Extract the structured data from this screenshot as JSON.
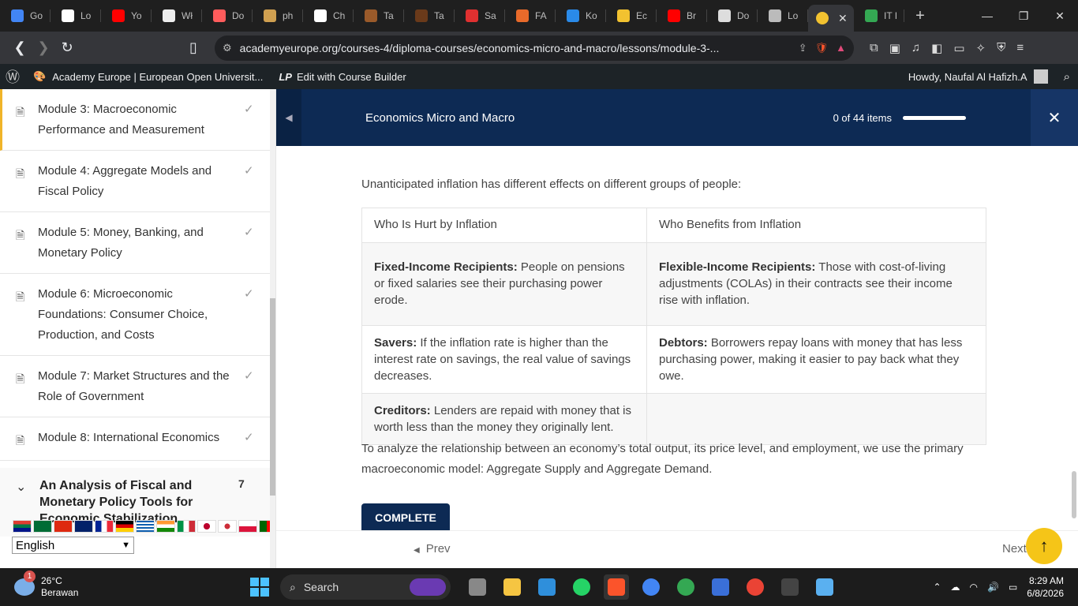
{
  "browser": {
    "tabs": [
      {
        "label": "Go",
        "color": "#4285f4"
      },
      {
        "label": "Lo",
        "color": "#ffffff"
      },
      {
        "label": "Yo",
        "color": "#ff0000"
      },
      {
        "label": "Wł",
        "color": "#eeeeee"
      },
      {
        "label": "Do",
        "color": "#ff5c5c"
      },
      {
        "label": "ph",
        "color": "#d0a050"
      },
      {
        "label": "Ch",
        "color": "#ffffff"
      },
      {
        "label": "Ta",
        "color": "#9a5a2a"
      },
      {
        "label": "Ta",
        "color": "#6a3a1a"
      },
      {
        "label": "Sa",
        "color": "#e03030"
      },
      {
        "label": "FA",
        "color": "#e86a2a"
      },
      {
        "label": "Ko",
        "color": "#2a8ae8"
      },
      {
        "label": "Ec",
        "color": "#f2c230"
      },
      {
        "label": "Br",
        "color": "#ff0000"
      },
      {
        "label": "Do",
        "color": "#dddddd"
      },
      {
        "label": "Lo",
        "color": "#bbbbbb"
      }
    ],
    "active_tab": {
      "label": "",
      "color": "#f2c230"
    },
    "last_tab": {
      "label": "IT I",
      "color": "#34a853"
    },
    "url": "academyeurope.org/courses-4/diploma-courses/economics-micro-and-macro/lessons/module-3-..."
  },
  "adminbar": {
    "site_name": "Academy Europe | European Open Universit...",
    "builder_label": "Edit with Course Builder",
    "howdy": "Howdy, Naufal Al Hafizh.A"
  },
  "sidebar": {
    "modules": [
      {
        "label": "Module 3: Macroeconomic Performance and Measurement"
      },
      {
        "label": "Module 4: Aggregate Models and Fiscal Policy"
      },
      {
        "label": "Module 5: Money, Banking, and Monetary Policy"
      },
      {
        "label": "Module 6: Microeconomic Foundations: Consumer Choice, Production, and Costs"
      },
      {
        "label": "Module 7: Market Structures and the Role of Government"
      },
      {
        "label": "Module 8: International Economics"
      }
    ],
    "section_title": "An Analysis of Fiscal and Monetary Policy Tools for Economic Stabilization",
    "section_count": "7",
    "language": "English"
  },
  "course": {
    "title": "Economics Micro and Macro",
    "progress_text": "0 of 44 items",
    "progress_fraction": 0
  },
  "lesson": {
    "intro": "Unanticipated inflation has different effects on different groups of people:",
    "table": {
      "headers": [
        "Who Is Hurt by Inflation",
        "Who Benefits from Inflation"
      ],
      "rows": [
        {
          "hurt_term": "Fixed-Income Recipients:",
          "hurt_text": " People on pensions or fixed salaries see their purchasing power erode.",
          "benefit_term": "Flexible-Income Recipients:",
          "benefit_text": " Those with cost-of-living adjustments (COLAs) in their contracts see their income rise with inflation."
        },
        {
          "hurt_term": "Savers:",
          "hurt_text": " If the inflation rate is higher than the interest rate on savings, the real value of savings decreases.",
          "benefit_term": "Debtors:",
          "benefit_text": " Borrowers repay loans with money that has less purchasing power, making it easier to pay back what they owe."
        },
        {
          "hurt_term": "Creditors:",
          "hurt_text": " Lenders are repaid with money that is worth less than the money they originally lent.",
          "benefit_term": "",
          "benefit_text": ""
        }
      ]
    },
    "paragraph": "To analyze the relationship between an economy’s total output, its price level, and employment, we use the primary macroeconomic model: Aggregate Supply and Aggregate Demand.",
    "complete_label": "COMPLETE",
    "prev_label": "Prev",
    "next_label": "Next"
  },
  "taskbar": {
    "temperature": "26°C",
    "weather": "Berawan",
    "weather_badge": "1",
    "search_label": "Search",
    "time": "8:29 AM",
    "date": "6/8/2026"
  }
}
